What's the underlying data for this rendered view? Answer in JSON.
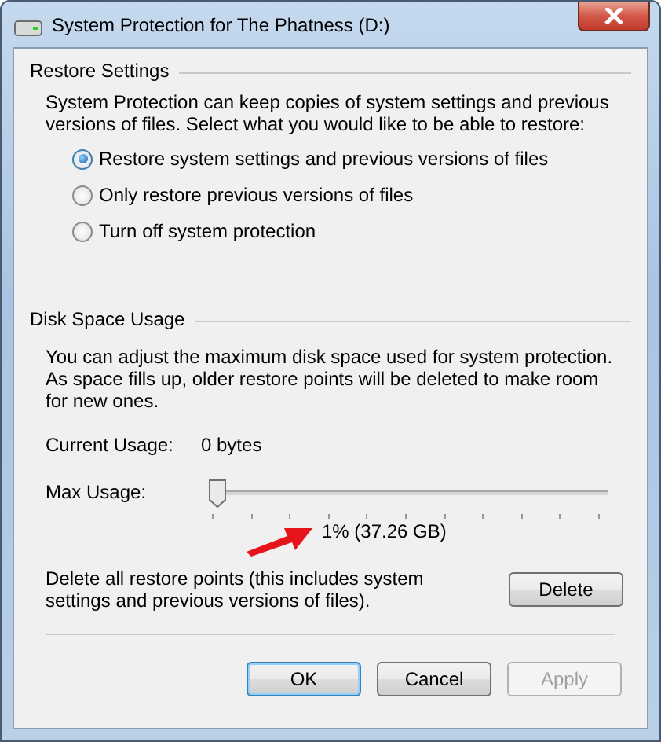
{
  "window": {
    "title": "System Protection for The Phatness (D:)"
  },
  "restore_settings": {
    "heading": "Restore Settings",
    "description": "System Protection can keep copies of system settings and previous versions of files. Select what you would like to be able to restore:",
    "options": [
      {
        "label": "Restore system settings and previous versions of files",
        "selected": true
      },
      {
        "label": "Only restore previous versions of files",
        "selected": false
      },
      {
        "label": "Turn off system protection",
        "selected": false
      }
    ]
  },
  "disk_space_usage": {
    "heading": "Disk Space Usage",
    "description": "You can adjust the maximum disk space used for system protection. As space fills up, older restore points will be deleted to make room for new ones.",
    "current_usage_label": "Current Usage:",
    "current_usage_value": "0 bytes",
    "max_usage_label": "Max Usage:",
    "max_usage": {
      "level": 0.01
    },
    "max_usage_reading": "1% (37.26 GB)",
    "delete_description": "Delete all restore points (this includes system settings and previous versions of files).",
    "delete_button": "Delete"
  },
  "buttons": [
    {
      "label": "OK",
      "default": true,
      "disabled": false
    },
    {
      "label": "Cancel",
      "default": false,
      "disabled": false
    },
    {
      "label": "Apply",
      "default": false,
      "disabled": true
    }
  ]
}
